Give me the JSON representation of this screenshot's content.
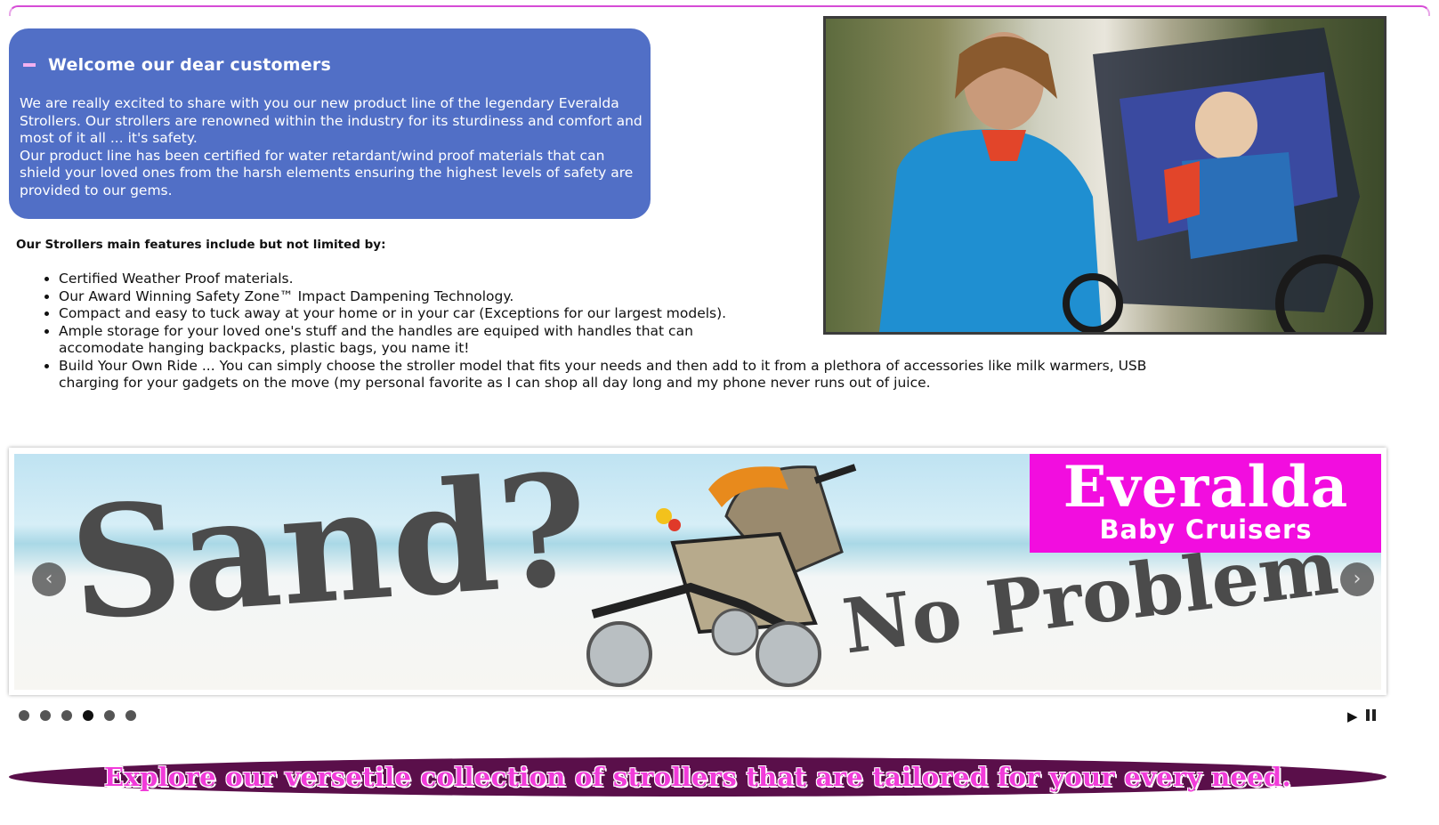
{
  "welcome": {
    "title": "Welcome our dear customers",
    "paragraph_1": "We are really excited to share with you our new product line of the legendary Everalda Strollers. Our strollers are renowned within the industry for its sturdiness and comfort and most of it all ... it's safety.",
    "paragraph_2": "Our product line has been certified for water retardant/wind proof materials that can shield your loved ones from the harsh elements ensuring the highest levels of safety are provided to our gems."
  },
  "features": {
    "intro": "Our Strollers main features include but not limited by:",
    "items": [
      "Certified Weather Proof materials.",
      "Our Award Winning Safety Zone™ Impact Dampening Technology.",
      "Compact and easy to tuck away at your home or in your car (Exceptions for our largest models).",
      "Ample storage for your loved one's stuff and the handles are equiped with handles that can accomodate hanging backpacks, plastic bags, you name it!",
      "Build Your Own Ride ... You can simply choose the stroller model that fits your needs and then add to it from a plethora of accessories like milk warmers, USB charging for your gadgets on the move (my personal favorite as I can shop all day long and my phone never runs out of juice."
    ]
  },
  "slider": {
    "slide_text_1": "Sand?",
    "slide_text_2": "No Problem",
    "brand_name": "Everalda",
    "brand_sub": "Baby Cruisers",
    "prev_icon": "chevron-left-icon",
    "next_icon": "chevron-right-icon",
    "dot_count": 6,
    "active_dot": 4
  },
  "banner": {
    "text": "Explore our versetile collection of strollers that are tailored for your every need."
  },
  "colors": {
    "welcome_bg": "#516fc6",
    "brand_pink": "#f20ddf",
    "banner_bg": "#5a0f4a",
    "banner_text": "#f13bd9",
    "top_rule": "#d64cd6"
  }
}
